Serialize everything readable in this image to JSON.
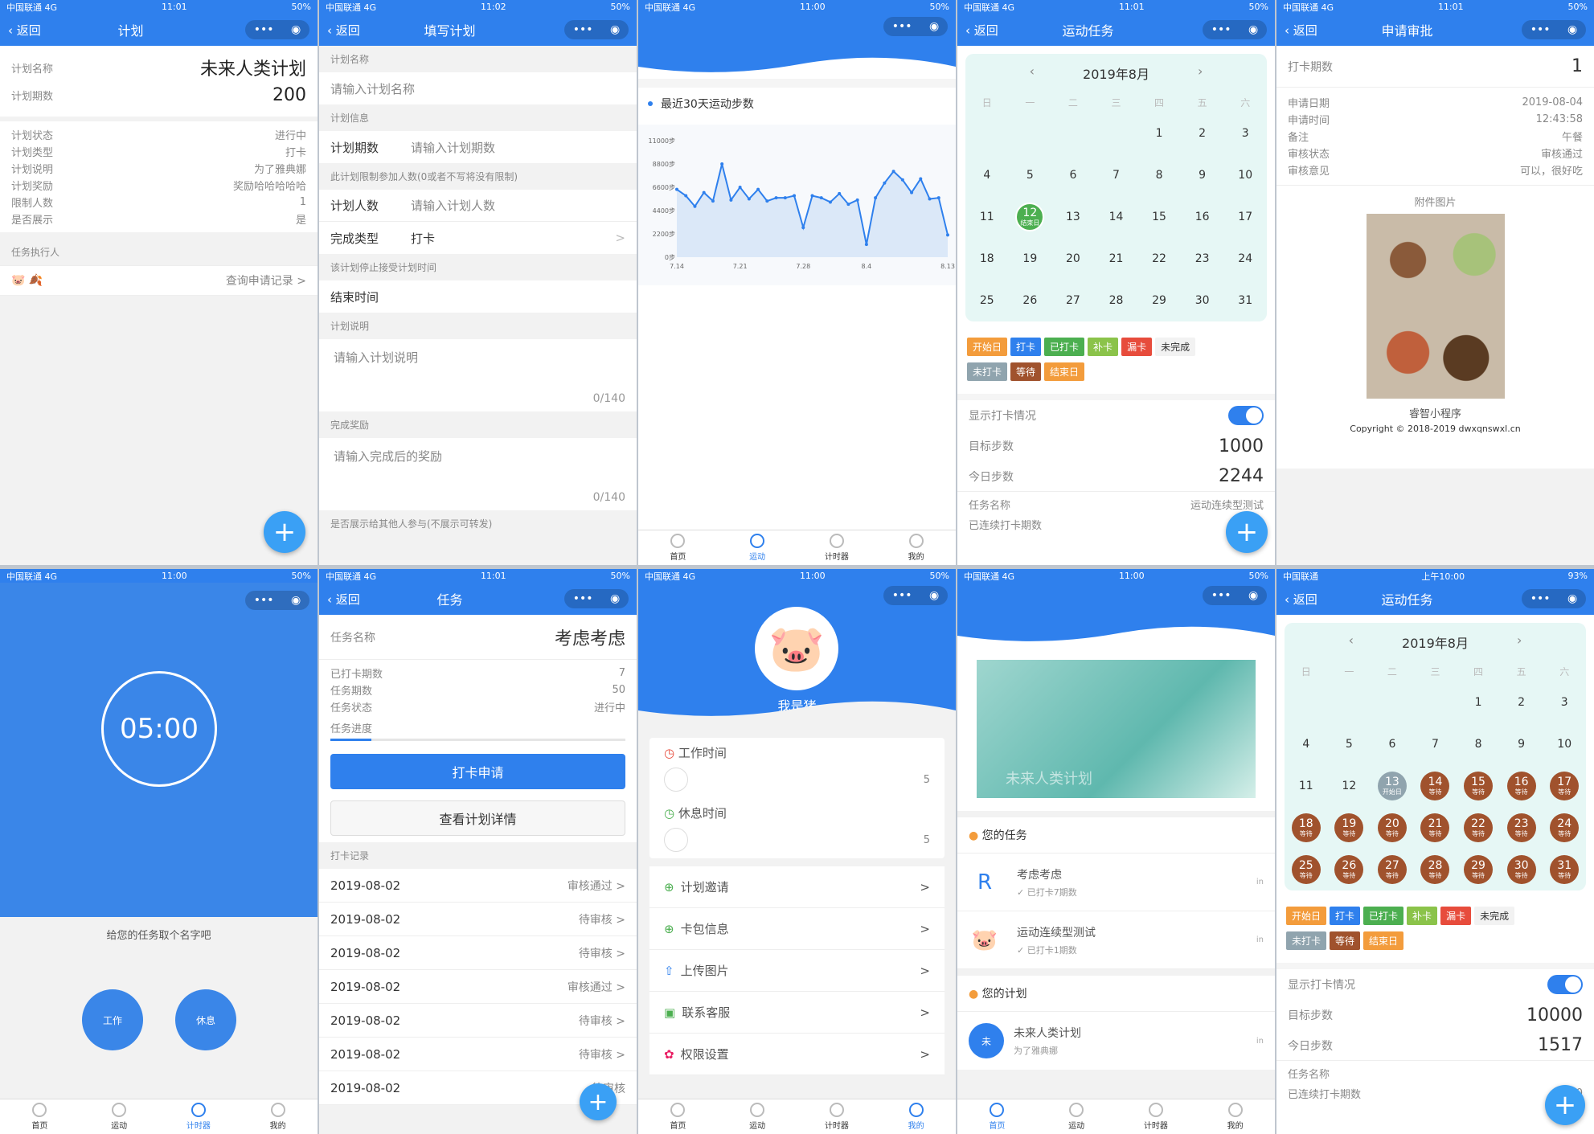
{
  "status": {
    "carrier": "中国联通 4G",
    "battery": "50%",
    "s1": "11:01",
    "s2": "11:02",
    "s3": "11:00",
    "s4": "11:01",
    "s5": "11:01",
    "s6": "11:00",
    "s7": "11:01",
    "s8": "11:00",
    "s9": "11:00",
    "s10_carrier": "中国联通",
    "s10_time": "上午10:00",
    "s10_battery": "93%"
  },
  "common": {
    "back": "返回",
    "more": "•••",
    "target": "◉",
    "plus": "+",
    "chev": ">"
  },
  "tabs": [
    "首页",
    "运动",
    "计时器",
    "我的"
  ],
  "plan": {
    "title": "计划",
    "name_label": "计划名称",
    "name": "未来人类计划",
    "periods_label": "计划期数",
    "periods": "200",
    "rows": [
      [
        "计划状态",
        "进行中"
      ],
      [
        "计划类型",
        "打卡"
      ],
      [
        "计划说明",
        "为了雅典娜"
      ],
      [
        "计划奖励",
        "奖励哈哈哈哈哈"
      ],
      [
        "限制人数",
        "1"
      ],
      [
        "是否展示",
        "是"
      ]
    ],
    "executor": "任务执行人",
    "query": "查询申请记录 >"
  },
  "fill": {
    "title": "填写计划",
    "s_name": "计划名称",
    "name_ph": "请输入计划名称",
    "s_info": "计划信息",
    "periods_label": "计划期数",
    "periods_ph": "请输入计划期数",
    "s_limit": "此计划限制参加人数(0或者不写将没有限制)",
    "people_label": "计划人数",
    "people_ph": "请输入计划人数",
    "type_label": "完成类型",
    "type_val": "打卡",
    "s_stop": "该计划停止接受计划时间",
    "end_label": "结束时间",
    "s_desc": "计划说明",
    "desc_ph": "请输入计划说明",
    "desc_count": "0/140",
    "s_reward": "完成奖励",
    "reward_ph": "请输入完成后的奖励",
    "reward_count": "0/140",
    "s_show": "是否展示给其他人参与(不展示可转发)"
  },
  "steps": {
    "title": "最近30天运动步数",
    "chart_data": {
      "type": "area",
      "x_ticks": [
        "7.14",
        "7.21",
        "7.28",
        "8.4",
        "8.13"
      ],
      "y_ticks": [
        "11000步",
        "8800步",
        "6600步",
        "4400步",
        "2200步",
        "0步"
      ],
      "ylim": [
        0,
        11000
      ],
      "values": [
        6400,
        5800,
        4800,
        6100,
        5300,
        8800,
        5400,
        6600,
        5500,
        6400,
        5300,
        5600,
        5600,
        5800,
        2800,
        5800,
        5600,
        5200,
        6000,
        5000,
        5400,
        1200,
        5600,
        7000,
        8100,
        7300,
        6100,
        7400,
        5500,
        5600,
        2100
      ]
    }
  },
  "sport": {
    "title": "运动任务",
    "month": "2019年8月",
    "weekdays": [
      "日",
      "一",
      "二",
      "三",
      "四",
      "五",
      "六"
    ],
    "tags1": [
      [
        "开始日",
        "#f39c3c"
      ],
      [
        "打卡",
        "#2f80ed"
      ],
      [
        "已打卡",
        "#4caf50"
      ],
      [
        "补卡",
        "#8bc34a"
      ],
      [
        "漏卡",
        "#e74c3c"
      ],
      [
        "未完成",
        "#f2f2f2"
      ]
    ],
    "tags2": [
      [
        "未打卡",
        "#90a4ae"
      ],
      [
        "等待",
        "#a0522d"
      ],
      [
        "结束日",
        "#f39c3c"
      ]
    ],
    "show": "显示打卡情况",
    "target_label": "目标步数",
    "target": "1000",
    "today_label": "今日步数",
    "today": "2244",
    "task_label": "任务名称",
    "task_val": "运动连续型测试",
    "cont_label": "已连续打卡期数",
    "cont_val": "1",
    "end_day": "结束日"
  },
  "approve": {
    "title": "申请审批",
    "period_label": "打卡期数",
    "period": "1",
    "rows": [
      [
        "申请日期",
        "2019-08-04"
      ],
      [
        "申请时间",
        "12:43:58"
      ],
      [
        "备注",
        "午餐"
      ],
      [
        "审核状态",
        "审核通过"
      ],
      [
        "审核意见",
        "可以，很好吃"
      ]
    ],
    "attach": "附件图片",
    "app": "睿智小程序",
    "copy": "Copyright © 2018-2019 dwxqnswxl.cn"
  },
  "timer": {
    "time": "05:00",
    "hint": "给您的任务取个名字吧",
    "work": "工作",
    "rest": "休息"
  },
  "task": {
    "title": "任务",
    "name_label": "任务名称",
    "name": "考虑考虑",
    "rows": [
      [
        "已打卡期数",
        "7"
      ],
      [
        "任务期数",
        "50"
      ],
      [
        "任务状态",
        "进行中"
      ]
    ],
    "progress": "任务进度",
    "progress_val": 0.14,
    "apply": "打卡申请",
    "detail": "查看计划详情",
    "records": "打卡记录",
    "list": [
      [
        "2019-08-02",
        "审核通过 >"
      ],
      [
        "2019-08-02",
        "待审核 >"
      ],
      [
        "2019-08-02",
        "待审核 >"
      ],
      [
        "2019-08-02",
        "审核通过 >"
      ],
      [
        "2019-08-02",
        "待审核 >"
      ],
      [
        "2019-08-02",
        "待审核 >"
      ],
      [
        "2019-08-02",
        "待审核"
      ]
    ]
  },
  "mine": {
    "name": "我是猪",
    "work": "工作时间",
    "work_val": "5",
    "rest": "休息时间",
    "rest_val": "5",
    "menu": [
      "计划邀请",
      "卡包信息",
      "上传图片",
      "联系客服",
      "权限设置"
    ]
  },
  "home": {
    "banner_text": "未来人类计划",
    "your_tasks": "您的任务",
    "tasks": [
      [
        "考虑考虑",
        "✓ 已打卡7期数",
        "in"
      ],
      [
        "运动连续型测试",
        "✓ 已打卡1期数",
        "in"
      ]
    ],
    "your_plans": "您的计划",
    "plans": [
      [
        "未来人类计划",
        "为了雅典娜",
        "in",
        "未"
      ]
    ]
  },
  "sport2": {
    "title": "运动任务",
    "month": "2019年8月",
    "start": "开始日",
    "wait": "等待",
    "show": "显示打卡情况",
    "target_label": "目标步数",
    "target": "10000",
    "today_label": "今日步数",
    "today": "1517",
    "task_label": "任务名称",
    "cont_label": "已连续打卡期数",
    "cont_val": "0"
  }
}
